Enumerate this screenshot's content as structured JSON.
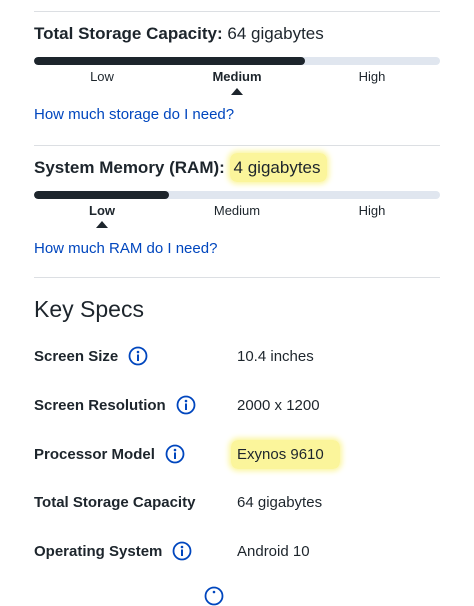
{
  "storage": {
    "label": "Total Storage Capacity:",
    "value": "64 gigabytes",
    "level_fraction": 0.667,
    "levels": [
      "Low",
      "Medium",
      "High"
    ],
    "active_level": "Medium",
    "link": "How much storage do I need?"
  },
  "memory": {
    "label": "System Memory (RAM):",
    "value": "4 gigabytes",
    "level_fraction": 0.333,
    "levels": [
      "Low",
      "Medium",
      "High"
    ],
    "active_level": "Low",
    "link": "How much RAM do I need?"
  },
  "key_specs": {
    "heading": "Key Specs",
    "rows": [
      {
        "label": "Screen Size",
        "value": "10.4 inches",
        "info": true
      },
      {
        "label": "Screen Resolution",
        "value": "2000 x 1200",
        "info": true
      },
      {
        "label": "Processor Model",
        "value": "Exynos 9610",
        "info": true
      },
      {
        "label": "Total Storage Capacity",
        "value": "64 gigabytes",
        "info": false
      },
      {
        "label": "Operating System",
        "value": "Android 10",
        "info": true
      }
    ]
  },
  "colors": {
    "link": "#0046be",
    "text": "#1d252c",
    "bar_fill": "#1d252c",
    "bar_track": "#e0e6ef",
    "highlight": "#fbf59b",
    "info_icon": "#0046be"
  },
  "icons": {
    "info": "info-circle-icon",
    "pointer": "caret-up-icon"
  }
}
